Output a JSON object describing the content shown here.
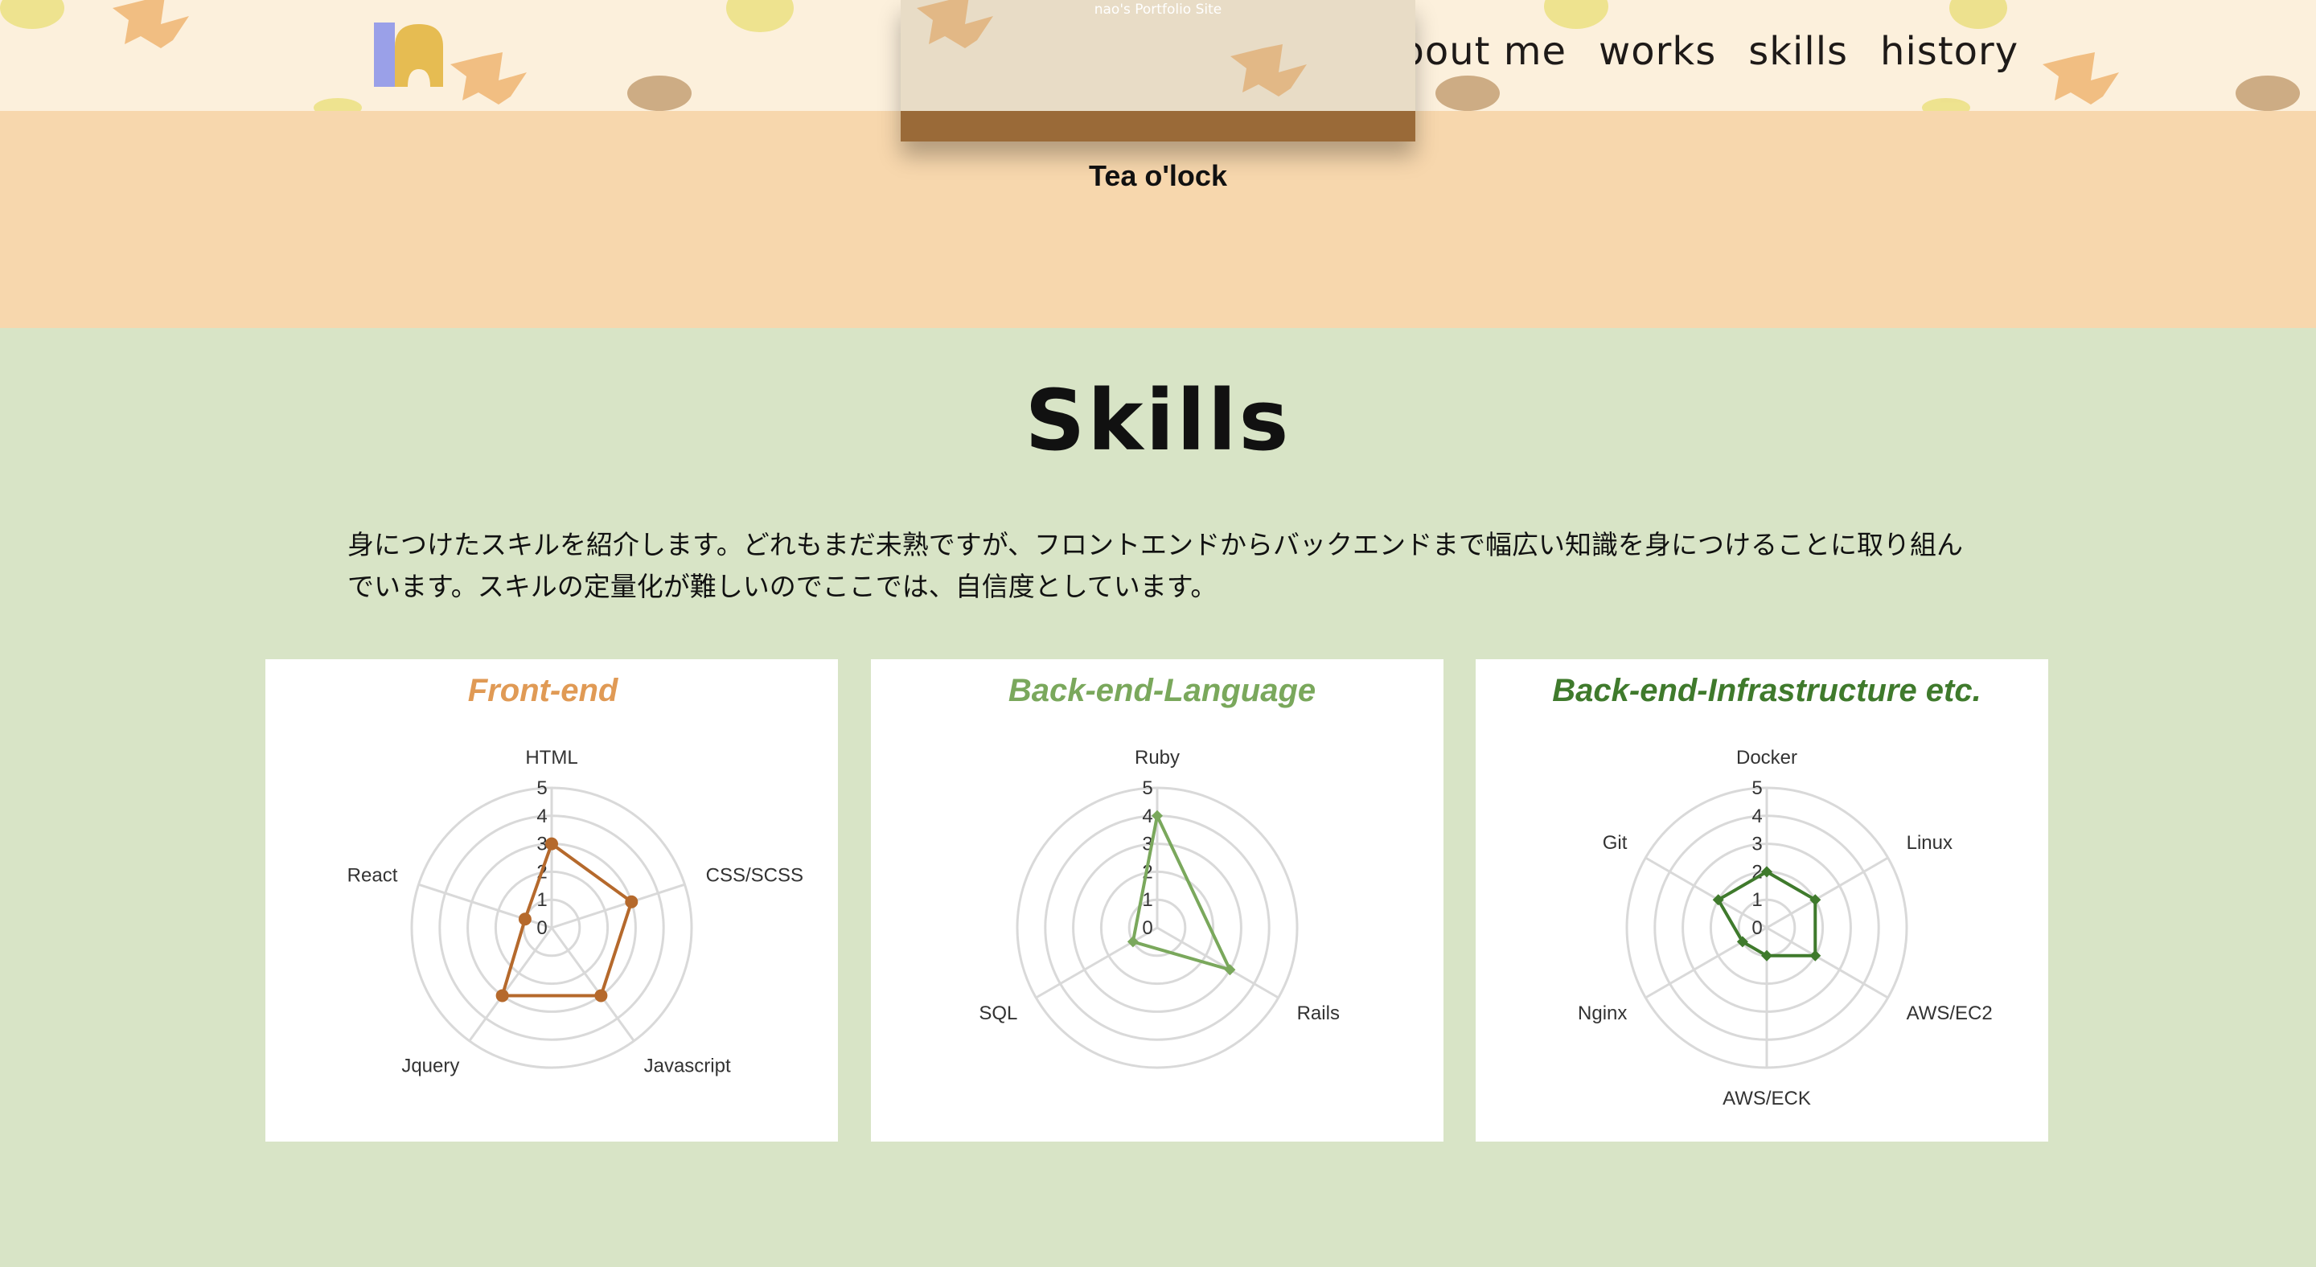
{
  "header": {
    "nav": [
      {
        "label": "about me"
      },
      {
        "label": "works"
      },
      {
        "label": "skills"
      },
      {
        "label": "history"
      }
    ]
  },
  "works": {
    "thumb_subtitle": "nao's Portfolio Site",
    "title": "Tea o'lock"
  },
  "skills": {
    "title": "Skills",
    "description": "身につけたスキルを紹介します。どれもまだ未熟ですが、フロントエンドからバックエンドまで幅広い知識を身につけることに取り組んでいます。スキルの定量化が難しいのでここでは、自信度としています。"
  },
  "colors": {
    "frontend": "#b5692c",
    "frontend_title": "#e09a55",
    "backend_lang": "#7aa85c",
    "backend_infra": "#3f7a2c",
    "grid": "#d9d9d9"
  },
  "chart_data": [
    {
      "type": "radar",
      "title": "Front-end",
      "categories": [
        "HTML",
        "CSS/SCSS",
        "Javascript",
        "Jquery",
        "React"
      ],
      "values": [
        3,
        3,
        3,
        3,
        1
      ],
      "rlim": [
        0,
        5
      ],
      "ticks": [
        0,
        1,
        2,
        3,
        4,
        5
      ]
    },
    {
      "type": "radar",
      "title": "Back-end-Language",
      "categories": [
        "Ruby",
        "Rails",
        "SQL"
      ],
      "values": [
        4,
        3,
        1
      ],
      "rlim": [
        0,
        5
      ],
      "ticks": [
        0,
        1,
        2,
        3,
        4,
        5
      ]
    },
    {
      "type": "radar",
      "title": "Back-end-Infrastructure etc.",
      "categories": [
        "Docker",
        "Linux",
        "AWS/EC2",
        "AWS/ECK",
        "Nginx",
        "Git"
      ],
      "values": [
        2,
        2,
        2,
        1,
        1,
        2
      ],
      "rlim": [
        0,
        5
      ],
      "ticks": [
        0,
        1,
        2,
        3,
        4,
        5
      ]
    }
  ]
}
